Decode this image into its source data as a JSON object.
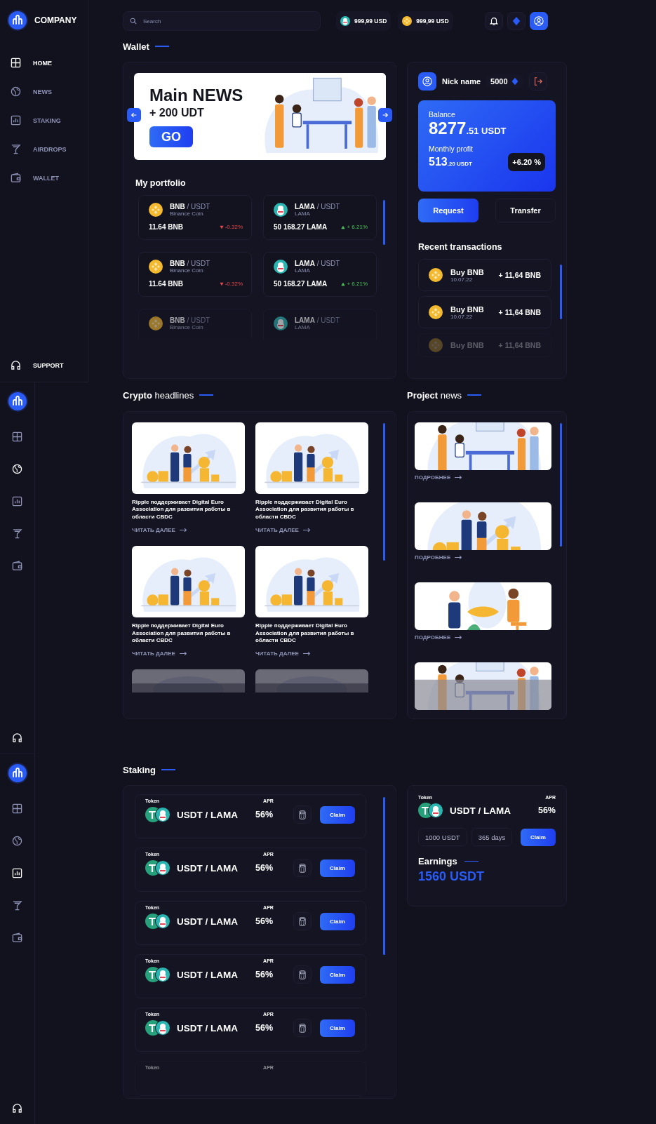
{
  "sidebars": [
    {
      "kind": "expanded",
      "brand": "COMPANY",
      "items": [
        {
          "label": "HOME",
          "selected": true
        },
        {
          "label": "NEWS",
          "selected": false
        },
        {
          "label": "STAKING",
          "selected": false
        },
        {
          "label": "AIRDROPS",
          "selected": false
        },
        {
          "label": "WALLET",
          "selected": false
        }
      ],
      "support": "SUPPORT"
    },
    {
      "kind": "collapsed",
      "items": [
        {
          "selected": false
        },
        {
          "selected": true
        },
        {
          "selected": false
        },
        {
          "selected": false
        },
        {
          "selected": false
        }
      ]
    },
    {
      "kind": "collapsed",
      "items": [
        {
          "selected": false
        },
        {
          "selected": false
        },
        {
          "selected": true
        },
        {
          "selected": false
        },
        {
          "selected": false
        }
      ]
    }
  ],
  "topbar": {
    "search": {
      "placeholder": "Search"
    },
    "balances": [
      {
        "kind": "lama",
        "amount": "999,99 USD"
      },
      {
        "kind": "bnb",
        "amount": "999,99 USD"
      }
    ]
  },
  "wallet": {
    "title": "Wallet",
    "banner": {
      "title": "Main NEWS",
      "subtitle": "+ 200 UDT",
      "button": "GO"
    },
    "portfolio": {
      "title": "My portfolio",
      "holdings": [
        {
          "kind": "bnb",
          "base": "BNB",
          "quote": "/ USDT",
          "name": "Binance Coin",
          "amount": "11.64 BNB",
          "change": "-0.32%",
          "rising": false,
          "faded": false
        },
        {
          "kind": "lama",
          "base": "LAMA",
          "quote": "/ USDT",
          "name": "LAMA",
          "amount": "50 168.27 LAMA",
          "change": "+ 6.21%",
          "rising": true,
          "faded": false
        },
        {
          "kind": "bnb",
          "base": "BNB",
          "quote": "/ USDT",
          "name": "Binance Coin",
          "amount": "11.64 BNB",
          "change": "-0.32%",
          "rising": false,
          "faded": false
        },
        {
          "kind": "lama",
          "base": "LAMA",
          "quote": "/ USDT",
          "name": "LAMA",
          "amount": "50 168.27 LAMA",
          "change": "+ 6.21%",
          "rising": true,
          "faded": false
        },
        {
          "kind": "bnb",
          "base": "BNB",
          "quote": "/ USDT",
          "name": "Binance Coin",
          "faded": true
        },
        {
          "kind": "lama",
          "base": "LAMA",
          "quote": "/ USDT",
          "name": "LAMA",
          "faded": true
        }
      ]
    }
  },
  "account": {
    "nickname": "Nick name",
    "points": "5000",
    "balance": {
      "label": "Balance",
      "whole": "8277",
      "fraction": ".51 USDT"
    },
    "profit": {
      "label": "Monthly profit",
      "whole": "513",
      "fraction": ".20 USDT",
      "change": "+6.20 %"
    },
    "buttons": [
      {
        "label": "Request",
        "primary": true
      },
      {
        "label": "Transfer",
        "primary": false
      }
    ],
    "transactions": {
      "title": "Recent transactions",
      "items": [
        {
          "title": "Buy BNB",
          "date": "10.07.22",
          "amount": "+ 11,64 BNB",
          "faded": false
        },
        {
          "title": "Buy BNB",
          "date": "10.07.22",
          "amount": "+ 11,64 BNB",
          "faded": false
        },
        {
          "title": "Buy BNB",
          "amount": "+ 11,64 BNB",
          "faded": true
        }
      ]
    }
  },
  "headlines": {
    "title": "**Crypto** headlines",
    "articles": [
      {
        "kind": "full",
        "headline": "Ripple поддерживает Digital Euro Association для развития работы в области CBDC",
        "link": "ЧИТАТЬ ДАЛЕЕ"
      },
      {
        "kind": "full",
        "headline": "Ripple поддерживает Digital Euro Association для развития работы в области CBDC",
        "link": "ЧИТАТЬ ДАЛЕЕ"
      },
      {
        "kind": "full",
        "headline": "Ripple поддерживает Digital Euro Association для развития работы в области CBDC",
        "link": "ЧИТАТЬ ДАЛЕЕ"
      },
      {
        "kind": "full",
        "headline": "Ripple поддерживает Digital Euro Association для развития работы в области CBDC",
        "link": "ЧИТАТЬ ДАЛЕЕ"
      },
      {
        "kind": "picture"
      },
      {
        "kind": "picture"
      }
    ]
  },
  "project": {
    "title": "**Project** news",
    "items": [
      {
        "kind": "full",
        "link": "ПОДРОБНЕЕ"
      },
      {
        "kind": "full",
        "link": "ПОДРОБНЕЕ"
      },
      {
        "kind": "full",
        "link": "ПОДРОБНЕЕ"
      },
      {
        "kind": "picture"
      }
    ]
  },
  "staking": {
    "title": "Staking",
    "pools": [
      {
        "kind": "full",
        "token_label": "Token",
        "apr_label": "APR",
        "pair": "USDT / LAMA",
        "apr": "56%",
        "button": "Claim"
      },
      {
        "kind": "full",
        "token_label": "Token",
        "apr_label": "APR",
        "pair": "USDT / LAMA",
        "apr": "56%",
        "button": "Claim"
      },
      {
        "kind": "full",
        "token_label": "Token",
        "apr_label": "APR",
        "pair": "USDT / LAMA",
        "apr": "56%",
        "button": "Claim"
      },
      {
        "kind": "full",
        "token_label": "Token",
        "apr_label": "APR",
        "pair": "USDT / LAMA",
        "apr": "56%",
        "button": "Claim"
      },
      {
        "kind": "full",
        "token_label": "Token",
        "apr_label": "APR",
        "pair": "USDT / LAMA",
        "apr": "56%",
        "button": "Claim"
      },
      {
        "kind": "preview",
        "token_label": "Token",
        "apr_label": "APR"
      }
    ],
    "detail": {
      "token_label": "Token",
      "apr_label": "APR",
      "pair": "USDT / LAMA",
      "apr": "56%",
      "amount": "1000 USDT",
      "period": "365 days",
      "button": "Claim",
      "earnings_title": "Earnings",
      "earnings": "1560 USDT"
    }
  }
}
